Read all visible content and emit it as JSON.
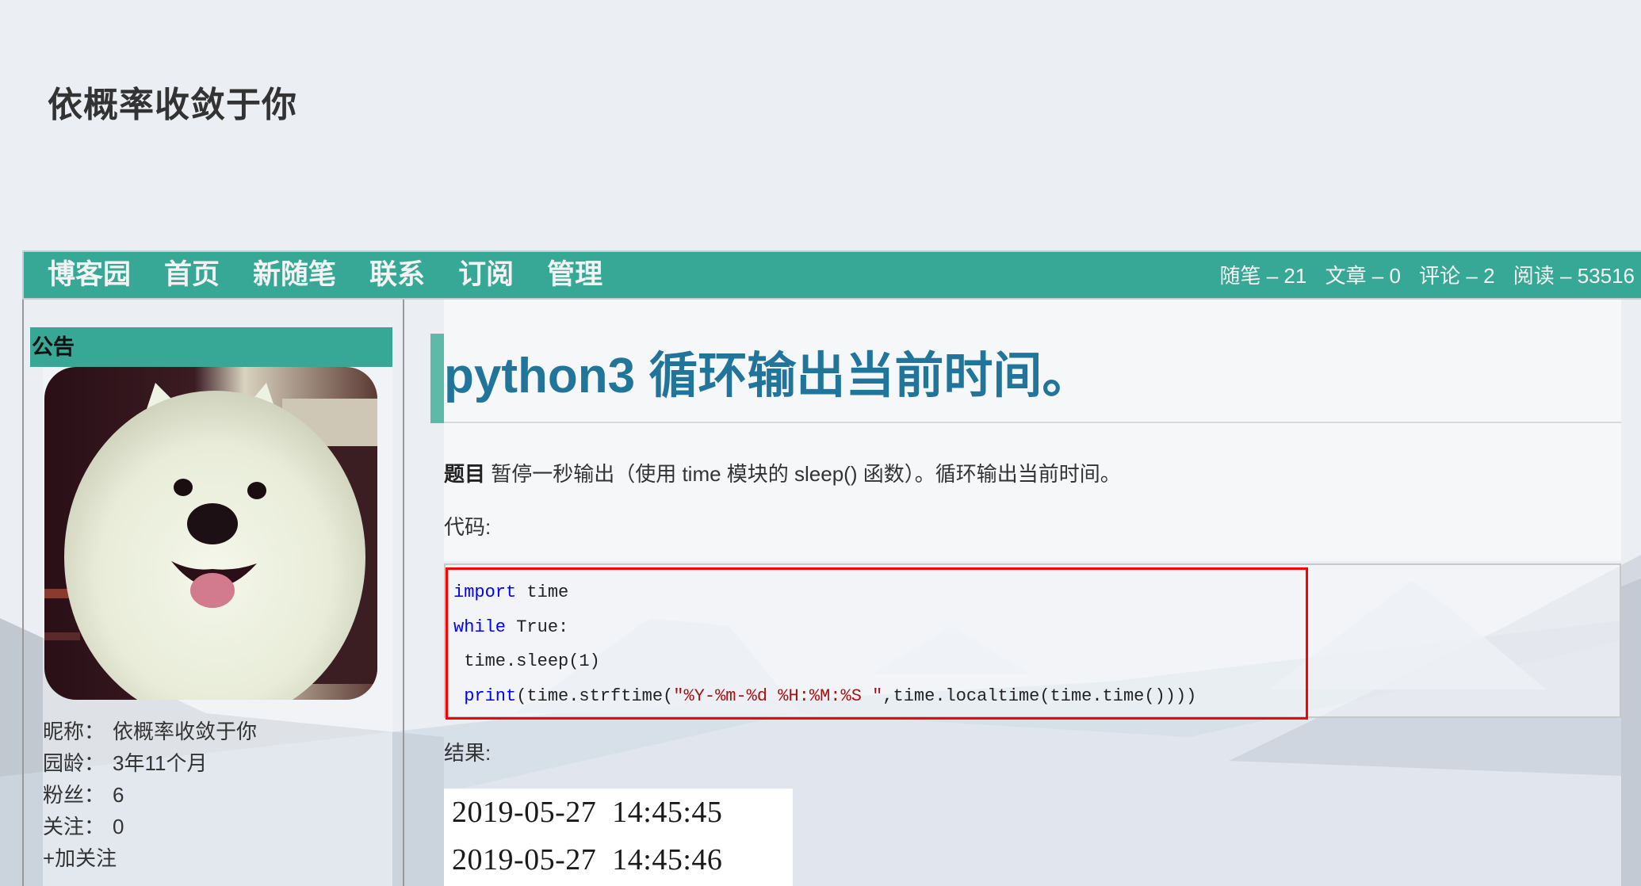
{
  "blog": {
    "title": "依概率收敛于你"
  },
  "navbar": {
    "bg_color": "#38a896",
    "items": [
      {
        "label": "博客园"
      },
      {
        "label": "首页"
      },
      {
        "label": "新随笔"
      },
      {
        "label": "联系"
      },
      {
        "label": "订阅"
      },
      {
        "label": "管理"
      }
    ],
    "stats": [
      {
        "label": "随笔 – 21"
      },
      {
        "label": "文章 – 0"
      },
      {
        "label": "评论 – 2"
      },
      {
        "label": "阅读 – 53516"
      }
    ]
  },
  "sidebar": {
    "notice_title": "公告",
    "avatar_icon": "samoyed-dog-avatar",
    "profile": [
      {
        "label": "昵称：",
        "value": "依概率收敛于你"
      },
      {
        "label": "园龄：",
        "value": "3年11个月"
      },
      {
        "label": "粉丝：",
        "value": "6"
      },
      {
        "label": "关注：",
        "value": "0"
      }
    ],
    "follow_label": "+加关注"
  },
  "post": {
    "title": "python3   循环输出当前时间。",
    "question_label": "题目",
    "question_text": " 暂停一秒输出（使用 time 模块的 sleep() 函数）。循环输出当前时间。",
    "code_label": "代码:",
    "code_lines": [
      [
        {
          "t": "import",
          "c": "kw"
        },
        {
          "t": " time",
          "c": ""
        }
      ],
      [
        {
          "t": "while",
          "c": "kw"
        },
        {
          "t": " True:",
          "c": ""
        }
      ],
      [
        {
          "t": " time.sleep(1)",
          "c": ""
        }
      ],
      [
        {
          "t": " ",
          "c": ""
        },
        {
          "t": "print",
          "c": "kw"
        },
        {
          "t": "(time.strftime(",
          "c": ""
        },
        {
          "t": "\"%Y-%m-%d %H:%M:%S \"",
          "c": "str"
        },
        {
          "t": ",time.localtime(time.time()))) ",
          "c": ""
        }
      ]
    ],
    "result_label": "结果:",
    "result_lines": [
      "2019-05-27  14:45:45",
      "2019-05-27  14:45:46"
    ]
  }
}
